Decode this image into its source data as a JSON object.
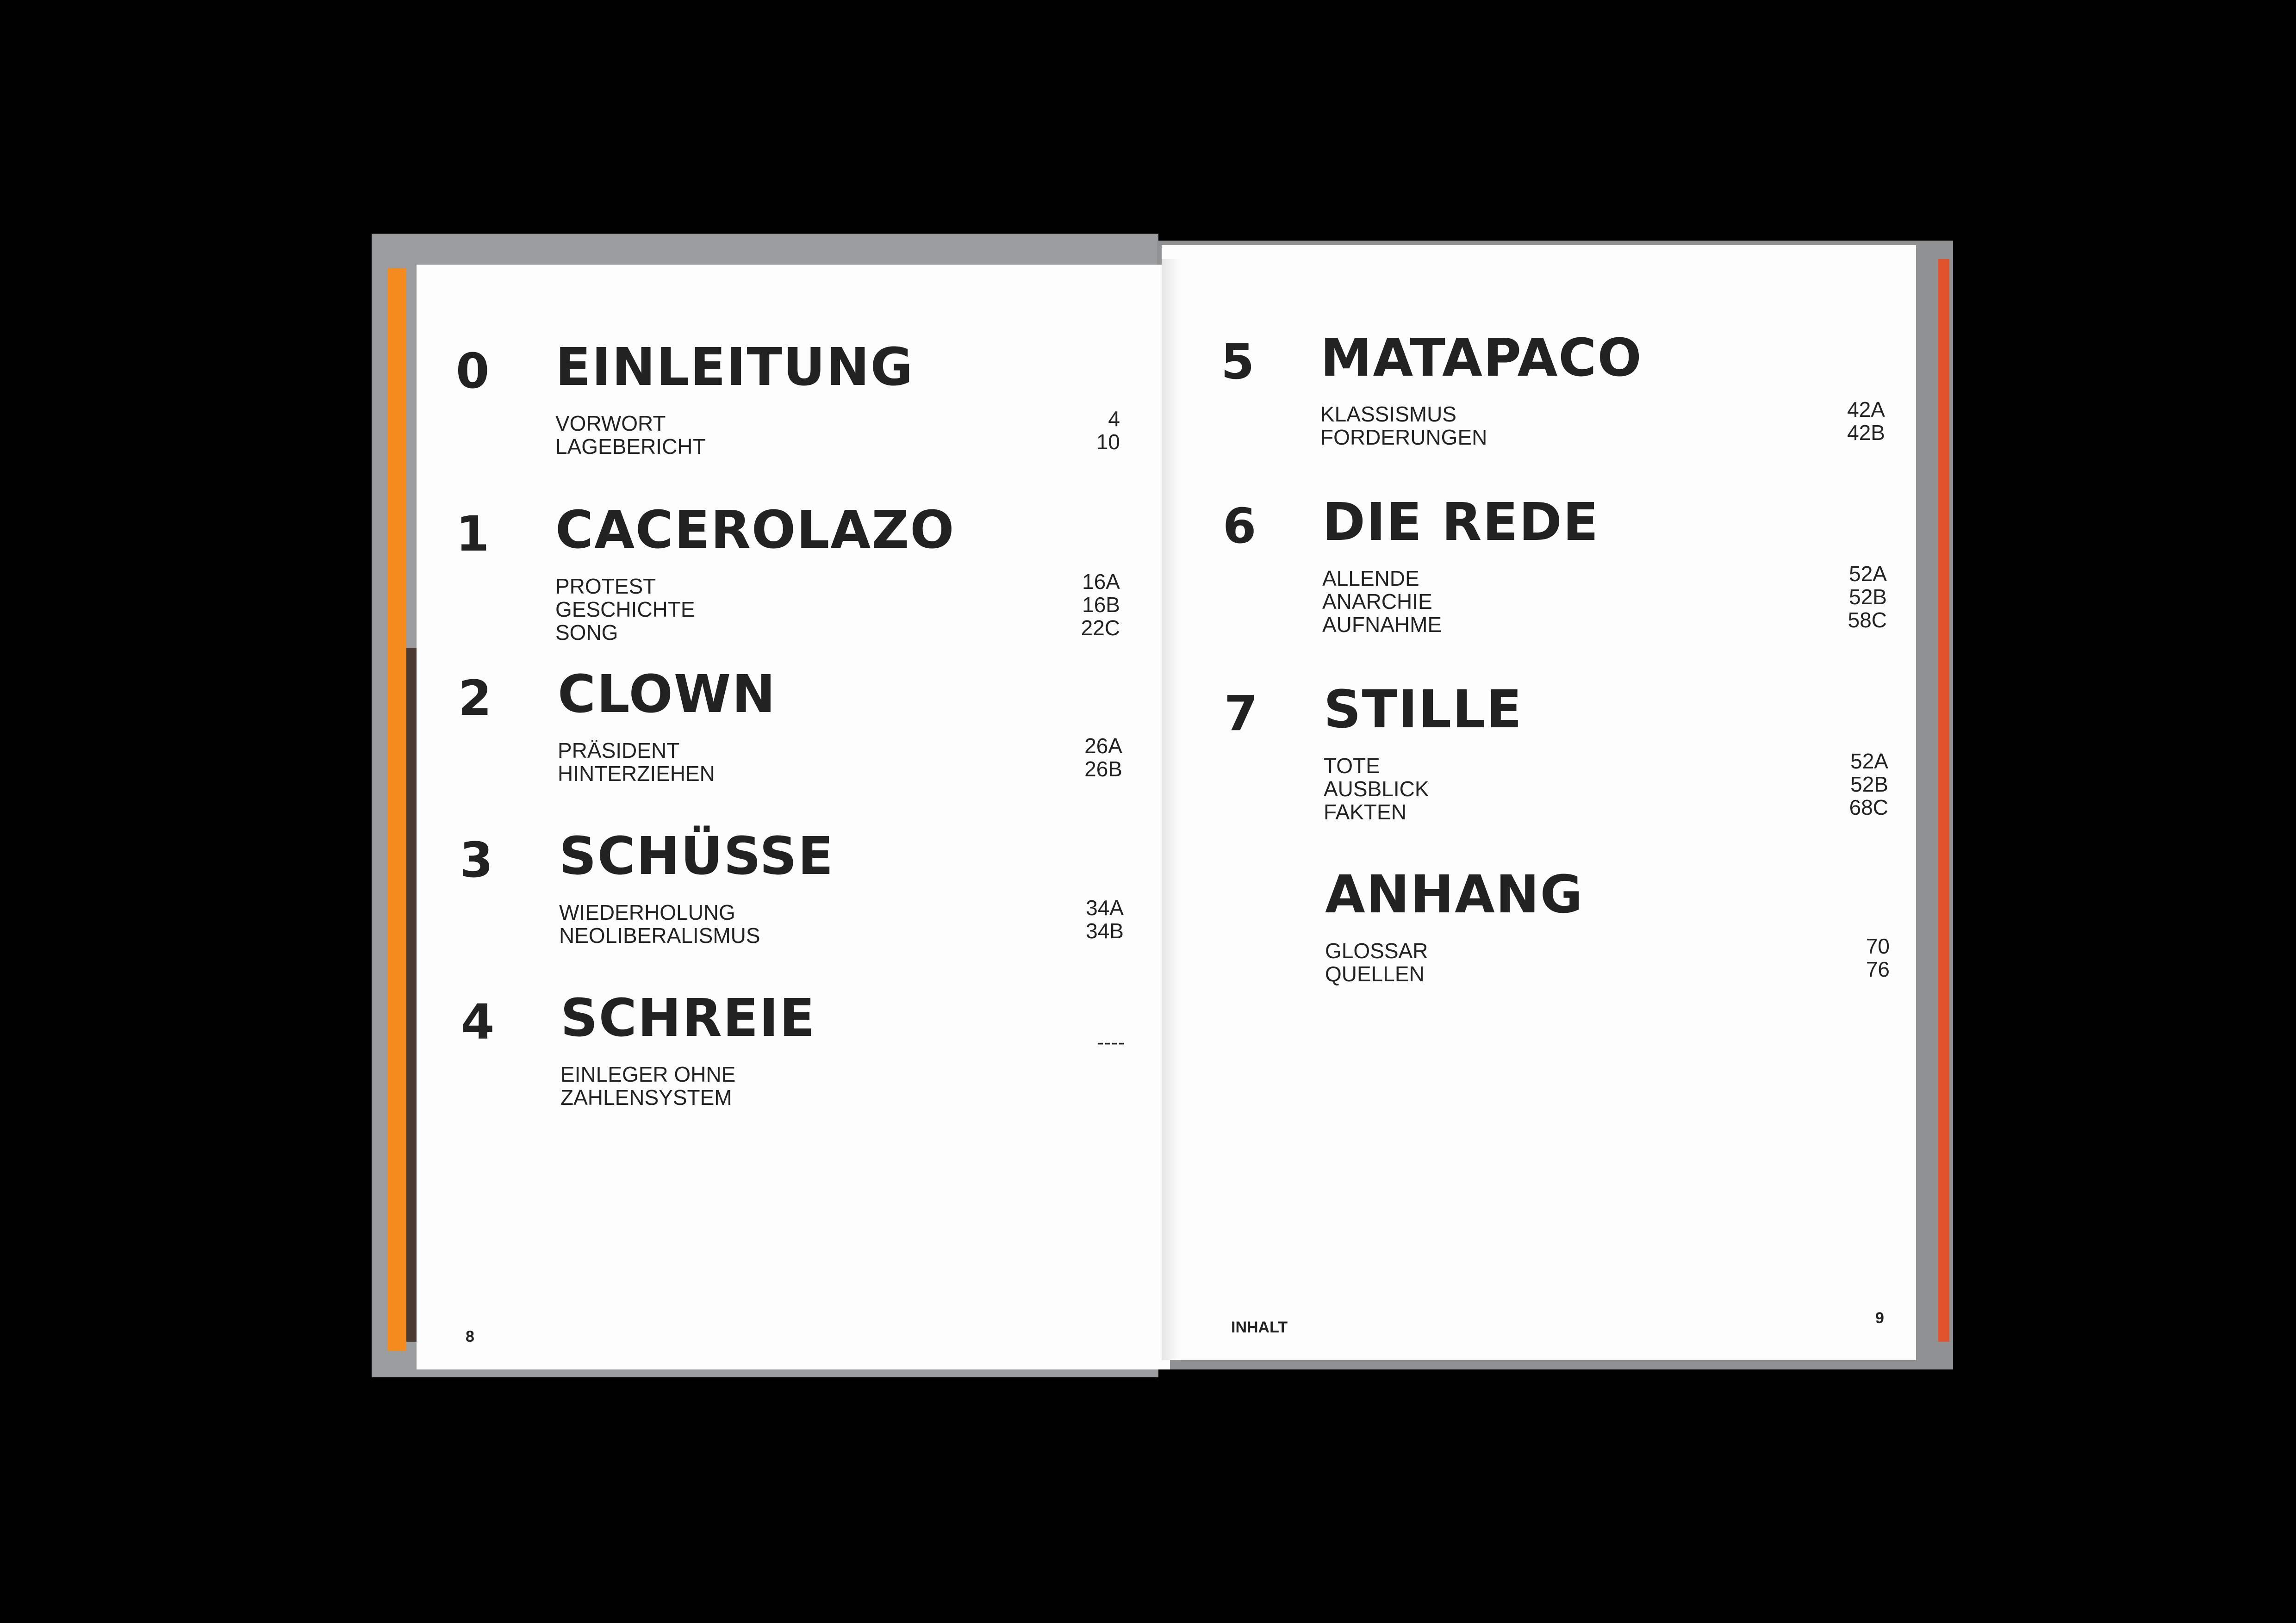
{
  "footer": {
    "page_left": "8",
    "running_head": "INHALT",
    "page_right": "9"
  },
  "left_sections": [
    {
      "number": "0",
      "title": "EINLEITUNG",
      "items": [
        {
          "label": "VORWORT",
          "page": "4"
        },
        {
          "label": "LAGEBERICHT",
          "page": "10"
        }
      ]
    },
    {
      "number": "1",
      "title": "CACEROLAZO",
      "items": [
        {
          "label": "PROTEST",
          "page": "16A"
        },
        {
          "label": "GESCHICHTE",
          "page": "16B"
        },
        {
          "label": "SONG",
          "page": "22C"
        }
      ]
    },
    {
      "number": "2",
      "title": "CLOWN",
      "items": [
        {
          "label": "PRÄSIDENT",
          "page": "26A"
        },
        {
          "label": "HINTERZIEHEN",
          "page": "26B"
        }
      ]
    },
    {
      "number": "3",
      "title": "SCHÜSSE",
      "items": [
        {
          "label": "WIEDERHOLUNG",
          "page": "34A"
        },
        {
          "label": "NEOLIBERALISMUS",
          "page": "34B"
        }
      ]
    },
    {
      "number": "4",
      "title": "SCHREIE",
      "items": [
        {
          "label": "EINLEGER OHNE",
          "page": "----"
        },
        {
          "label": "ZAHLENSYSTEM",
          "page": ""
        }
      ]
    }
  ],
  "right_sections": [
    {
      "number": "5",
      "title": "MATAPACO",
      "items": [
        {
          "label": "KLASSISMUS",
          "page": "42A"
        },
        {
          "label": "FORDERUNGEN",
          "page": "42B"
        }
      ]
    },
    {
      "number": "6",
      "title": "DIE REDE",
      "items": [
        {
          "label": "ALLENDE",
          "page": "52A"
        },
        {
          "label": "ANARCHIE",
          "page": "52B"
        },
        {
          "label": "AUFNAHME",
          "page": "58C"
        }
      ]
    },
    {
      "number": "7",
      "title": "STILLE",
      "items": [
        {
          "label": "TOTE",
          "page": "52A"
        },
        {
          "label": "AUSBLICK",
          "page": "52B"
        },
        {
          "label": "FAKTEN",
          "page": "68C"
        }
      ]
    },
    {
      "number": "",
      "title": "ANHANG",
      "items": [
        {
          "label": "GLOSSAR",
          "page": "70"
        },
        {
          "label": "QUELLEN",
          "page": "76"
        }
      ]
    }
  ]
}
